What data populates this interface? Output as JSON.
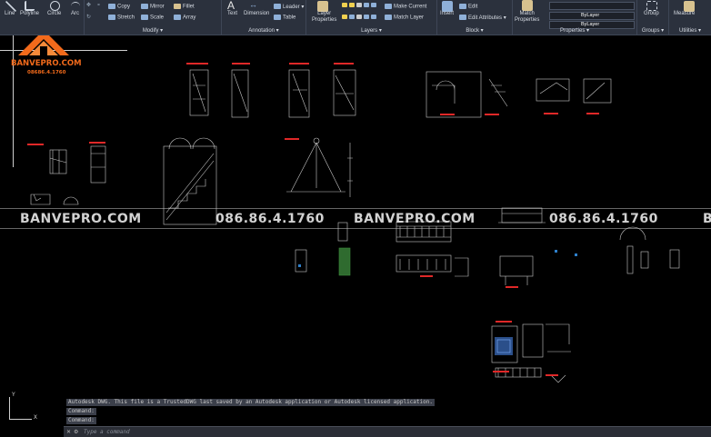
{
  "ribbon": {
    "draw": {
      "line": "Line",
      "polyline": "Polyline",
      "circle": "Circle",
      "arc": "Arc"
    },
    "modify": {
      "title": "Modify",
      "items": [
        "Copy",
        "Mirror",
        "Fillet",
        "Stretch",
        "Scale",
        "Array"
      ]
    },
    "annotation": {
      "title": "Annotation",
      "text": "Text",
      "dimension": "Dimension",
      "leader": "Leader",
      "table": "Table"
    },
    "layers": {
      "title": "Layers",
      "layer_properties_line1": "Layer",
      "layer_properties_line2": "Properties",
      "make_current": "Make Current",
      "match_layer": "Match Layer"
    },
    "block": {
      "title": "Block",
      "insert": "Insert",
      "edit": "Edit",
      "edit_attributes": "Edit Attributes"
    },
    "properties": {
      "title": "Properties",
      "match_line1": "Match",
      "match_line2": "Properties",
      "bylayer1": "ByLayer",
      "bylayer2": "ByLayer"
    },
    "groups": {
      "title": "Groups",
      "group": "Group"
    },
    "utilities": {
      "title": "Utilities",
      "measure": "Measure"
    }
  },
  "logo": {
    "brand": "BANVEPRO.COM",
    "phone": "08686.4.1760"
  },
  "watermarks": [
    "BANVEPRO.COM",
    "086.86.4.1760",
    "BANVEPRO.COM",
    "086.86.4.1760",
    "B"
  ],
  "command": {
    "history": [
      "Autodesk DWG.  This file is a TrustedDWG last saved by an Autodesk application or Autodesk licensed application.",
      "Command:",
      "Command:"
    ],
    "placeholder": "Type a command"
  },
  "colors": {
    "ribbon_bg": "#2b313d",
    "canvas_bg": "#000000",
    "accent_red": "#e02828",
    "logo_orange": "#f26a1b"
  }
}
